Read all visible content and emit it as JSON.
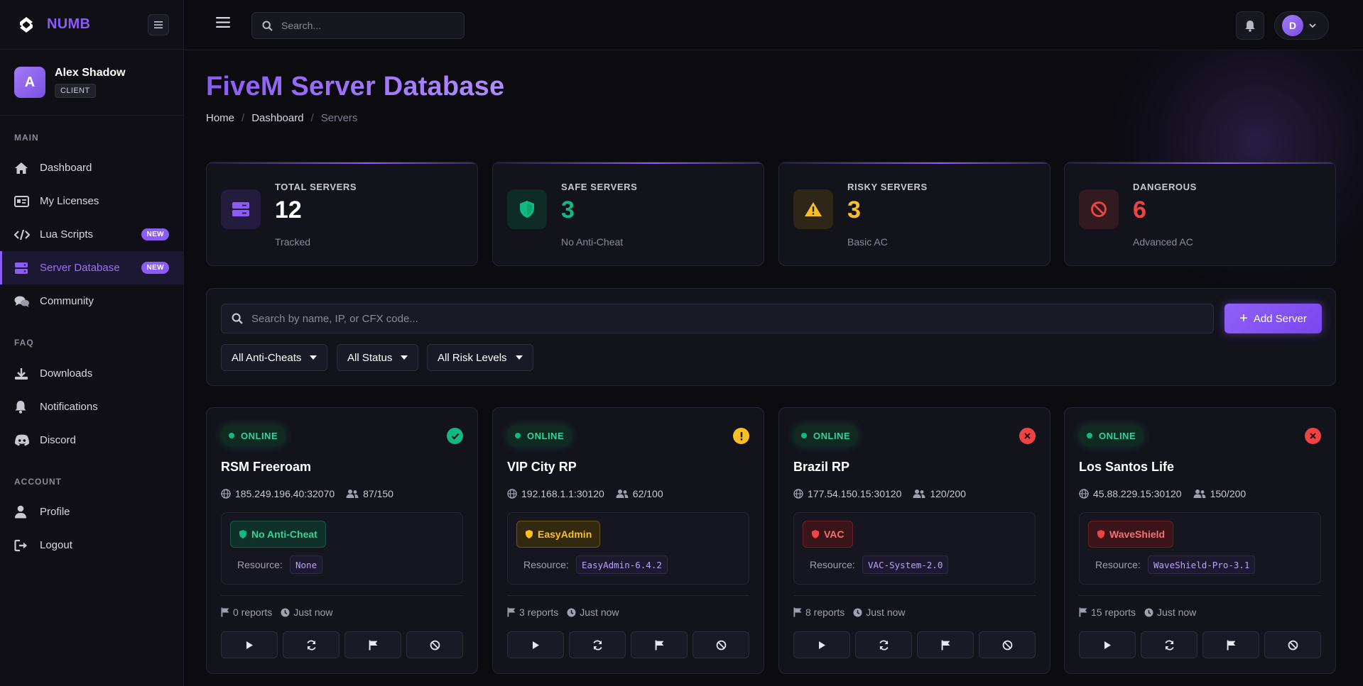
{
  "brand": {
    "name": "NUMB"
  },
  "user": {
    "name": "Alex Shadow",
    "initial": "A",
    "role": "CLIENT"
  },
  "nav": {
    "sections": [
      "MAIN",
      "FAQ",
      "ACCOUNT"
    ],
    "items": [
      {
        "label": "Dashboard",
        "icon": "home-icon"
      },
      {
        "label": "My Licenses",
        "icon": "id-card-icon"
      },
      {
        "label": "Lua Scripts",
        "icon": "code-icon",
        "badge": "NEW"
      },
      {
        "label": "Server Database",
        "icon": "server-icon",
        "badge": "NEW",
        "active": true
      },
      {
        "label": "Community",
        "icon": "comments-icon"
      },
      {
        "label": "Downloads",
        "icon": "download-icon"
      },
      {
        "label": "Notifications",
        "icon": "bell-icon"
      },
      {
        "label": "Discord",
        "icon": "discord-icon"
      },
      {
        "label": "Profile",
        "icon": "user-icon"
      },
      {
        "label": "Logout",
        "icon": "logout-icon"
      }
    ]
  },
  "topbar": {
    "search_placeholder": "Search...",
    "user_initial": "D"
  },
  "page": {
    "title": "FiveM Server Database",
    "breadcrumb": [
      "Home",
      "Dashboard",
      "Servers"
    ]
  },
  "stats": [
    {
      "label": "TOTAL SERVERS",
      "value": "12",
      "sub": "Tracked",
      "icon": "server-icon",
      "color": "#8b5cf6"
    },
    {
      "label": "SAFE SERVERS",
      "value": "3",
      "sub": "No Anti-Cheat",
      "icon": "shield-icon",
      "color": "#10b981"
    },
    {
      "label": "RISKY SERVERS",
      "value": "3",
      "sub": "Basic AC",
      "icon": "warning-icon",
      "color": "#fbbf24"
    },
    {
      "label": "DANGEROUS",
      "value": "6",
      "sub": "Advanced AC",
      "icon": "ban-icon",
      "color": "#ef4444"
    }
  ],
  "filters": {
    "search_placeholder": "Search by name, IP, or CFX code...",
    "add_button": "Add Server",
    "selects": [
      "All Anti-Cheats",
      "All Status",
      "All Risk Levels"
    ]
  },
  "servers": [
    {
      "status": "ONLINE",
      "name": "RSM Freeroam",
      "ip": "185.249.196.40:32070",
      "players": "87/150",
      "anticheat": "No Anti-Cheat",
      "resource_label": "Resource:",
      "resource": "None",
      "reports": "0 reports",
      "time": "Just now",
      "risk": "safe",
      "color": "#10b981"
    },
    {
      "status": "ONLINE",
      "name": "VIP City RP",
      "ip": "192.168.1.1:30120",
      "players": "62/100",
      "anticheat": "EasyAdmin",
      "resource_label": "Resource:",
      "resource": "EasyAdmin-6.4.2",
      "reports": "3 reports",
      "time": "Just now",
      "risk": "risky",
      "color": "#fbbf24"
    },
    {
      "status": "ONLINE",
      "name": "Brazil RP",
      "ip": "177.54.150.15:30120",
      "players": "120/200",
      "anticheat": "VAC",
      "resource_label": "Resource:",
      "resource": "VAC-System-2.0",
      "reports": "8 reports",
      "time": "Just now",
      "risk": "dangerous",
      "color": "#ef4444"
    },
    {
      "status": "ONLINE",
      "name": "Los Santos Life",
      "ip": "45.88.229.15:30120",
      "players": "150/200",
      "anticheat": "WaveShield",
      "resource_label": "Resource:",
      "resource": "WaveShield-Pro-3.1",
      "reports": "15 reports",
      "time": "Just now",
      "risk": "dangerous",
      "color": "#ef4444"
    }
  ]
}
